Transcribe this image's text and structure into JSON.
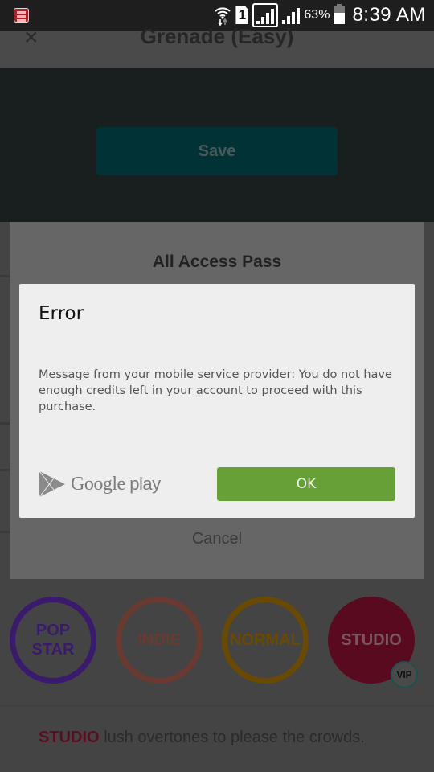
{
  "status_bar": {
    "icons": [
      "notification-app-icon",
      "wifi-transfer-icon",
      "sim-1-icon",
      "signal-sim1-icon",
      "signal-sim2-icon",
      "battery-icon"
    ],
    "battery_percent": "63%",
    "battery_level": 0.63,
    "time": "8:39 AM"
  },
  "app": {
    "title": "Grenade (Easy)",
    "close_icon": "×",
    "save_label": "Save"
  },
  "sheet": {
    "title": "All Access Pass",
    "cancel_label": "Cancel"
  },
  "error_dialog": {
    "title": "Error",
    "message": "Message from your mobile service provider: You do not have enough credits left in your account to proceed with this purchase.",
    "brand_google": "Google",
    "brand_play": " play",
    "ok_label": "OK",
    "ok_color": "#66a037"
  },
  "presets": [
    {
      "label": "POP STAR",
      "line1": "POP",
      "line2": "STAR",
      "color": "#3a1a6e",
      "style": "ring"
    },
    {
      "label": "INDIE",
      "line1": "INDIE",
      "line2": "",
      "color": "#6a3a30",
      "style": "ring"
    },
    {
      "label": "NORMAL",
      "line1": "NORMAL",
      "line2": "",
      "color": "#6a4a00",
      "style": "ring"
    },
    {
      "label": "STUDIO",
      "line1": "STUDIO",
      "line2": "",
      "color": "#5a0a1e",
      "style": "filled",
      "selected": true
    }
  ],
  "vip_badge": "VIP",
  "description": {
    "highlight": "STUDIO",
    "text": " lush overtones to please the crowds."
  }
}
